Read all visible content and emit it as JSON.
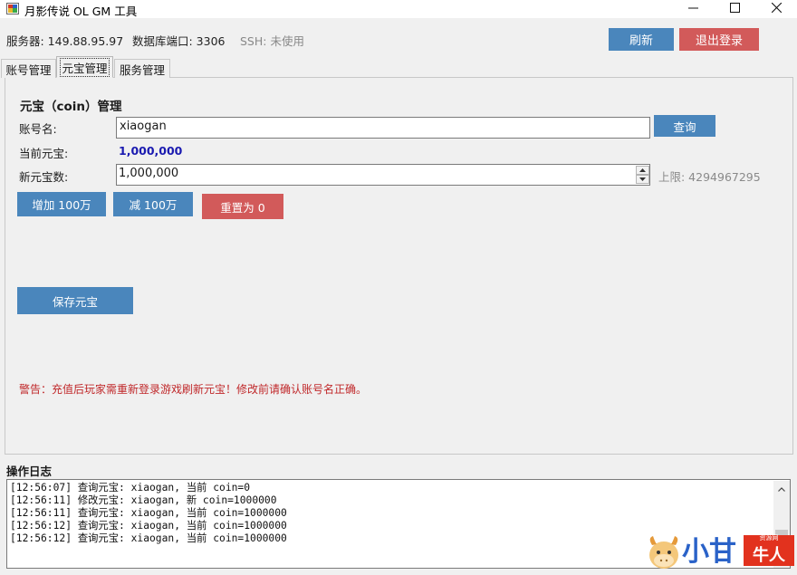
{
  "window": {
    "title": "月影传说 OL GM 工具"
  },
  "header": {
    "server": "服务器: 149.88.95.97",
    "db_port": "数据库端口: 3306",
    "ssh": "SSH: 未使用",
    "refresh_label": "刷新",
    "logout_label": "退出登录"
  },
  "tabs": [
    {
      "label": "账号管理"
    },
    {
      "label": "元宝管理"
    },
    {
      "label": "服务管理"
    }
  ],
  "coin_panel": {
    "title": "元宝（coin）管理",
    "account_label": "账号名:",
    "account_value": "xiaogan",
    "query_label": "查询",
    "current_label": "当前元宝:",
    "current_value": "1,000,000",
    "new_label": "新元宝数:",
    "new_value": "1,000,000",
    "limit_label": "上限: 4294967295",
    "add_label": "增加 100万",
    "sub_label": "减 100万",
    "reset_label": "重置为 0",
    "save_label": "保存元宝",
    "warning": "警告：充值后玩家需重新登录游戏刷新元宝！修改前请确认账号名正确。"
  },
  "log": {
    "title": "操作日志",
    "lines": [
      "[12:56:07] 查询元宝: xiaogan, 当前 coin=0",
      "[12:56:11] 修改元宝: xiaogan, 新 coin=1000000",
      "[12:56:11] 查询元宝: xiaogan, 当前 coin=1000000",
      "[12:56:12] 查询元宝: xiaogan, 当前 coin=1000000",
      "[12:56:12] 查询元宝: xiaogan, 当前 coin=1000000"
    ]
  },
  "watermark": {
    "text_main": "小甘",
    "text_badge": "牛人",
    "text_small": "资源网"
  },
  "colors": {
    "primary_button": "#4a86bc",
    "danger_button": "#d25a5a",
    "current_value": "#1a1ab0",
    "warning": "#c0282a"
  },
  "icons": {
    "app": "app-icon",
    "minimize": "minimize-icon",
    "maximize": "maximize-icon",
    "close": "close-icon"
  }
}
